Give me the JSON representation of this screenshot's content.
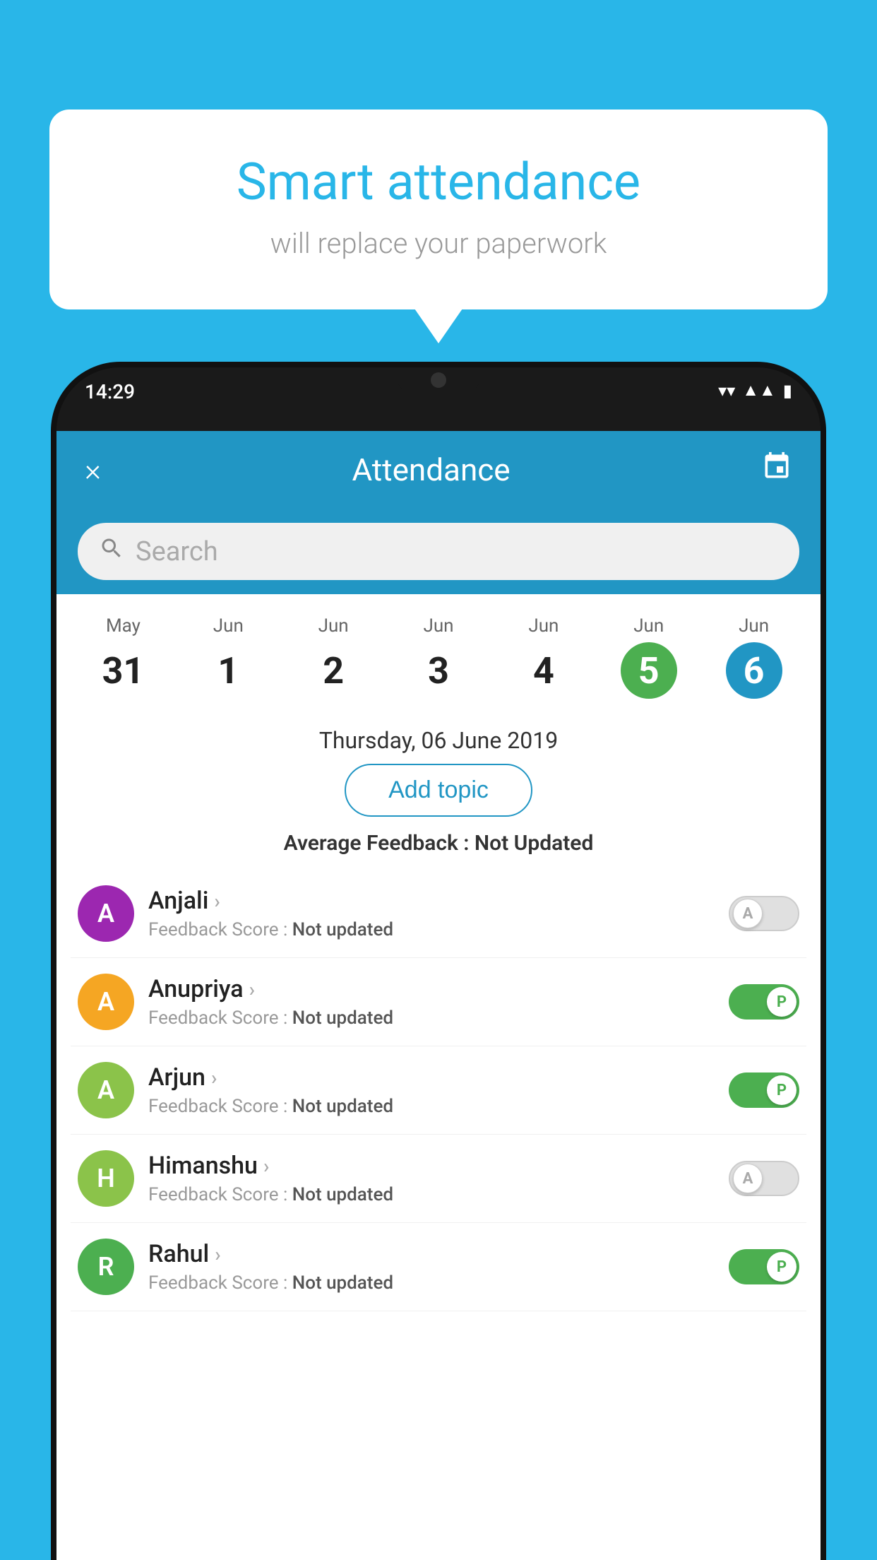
{
  "background_color": "#29b6e8",
  "speech_bubble": {
    "title": "Smart attendance",
    "subtitle": "will replace your paperwork"
  },
  "status_bar": {
    "time": "14:29",
    "wifi": "▼",
    "signal": "▲",
    "battery": "▮"
  },
  "app_header": {
    "title": "Attendance",
    "close_label": "×",
    "calendar_label": "📅"
  },
  "search": {
    "placeholder": "Search"
  },
  "dates": [
    {
      "month": "May",
      "day": "31",
      "state": "normal"
    },
    {
      "month": "Jun",
      "day": "1",
      "state": "normal"
    },
    {
      "month": "Jun",
      "day": "2",
      "state": "normal"
    },
    {
      "month": "Jun",
      "day": "3",
      "state": "normal"
    },
    {
      "month": "Jun",
      "day": "4",
      "state": "normal"
    },
    {
      "month": "Jun",
      "day": "5",
      "state": "today"
    },
    {
      "month": "Jun",
      "day": "6",
      "state": "selected"
    }
  ],
  "selected_date_label": "Thursday, 06 June 2019",
  "add_topic_label": "Add topic",
  "avg_feedback_label": "Average Feedback :",
  "avg_feedback_value": "Not Updated",
  "students": [
    {
      "name": "Anjali",
      "avatar_letter": "A",
      "avatar_color": "#9c27b0",
      "feedback_label": "Feedback Score :",
      "feedback_value": "Not updated",
      "attendance": "absent"
    },
    {
      "name": "Anupriya",
      "avatar_letter": "A",
      "avatar_color": "#f5a623",
      "feedback_label": "Feedback Score :",
      "feedback_value": "Not updated",
      "attendance": "present"
    },
    {
      "name": "Arjun",
      "avatar_letter": "A",
      "avatar_color": "#8bc34a",
      "feedback_label": "Feedback Score :",
      "feedback_value": "Not updated",
      "attendance": "present"
    },
    {
      "name": "Himanshu",
      "avatar_letter": "H",
      "avatar_color": "#8bc34a",
      "feedback_label": "Feedback Score :",
      "feedback_value": "Not updated",
      "attendance": "absent"
    },
    {
      "name": "Rahul",
      "avatar_letter": "R",
      "avatar_color": "#4caf50",
      "feedback_label": "Feedback Score :",
      "feedback_value": "Not updated",
      "attendance": "present"
    }
  ]
}
